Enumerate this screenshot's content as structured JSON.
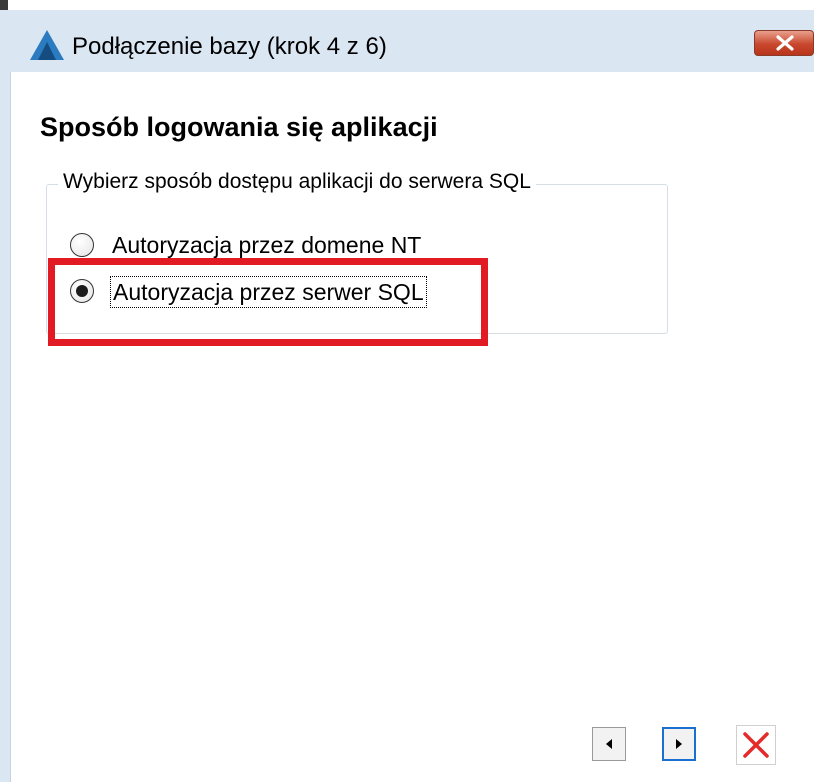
{
  "window": {
    "title": "Podłączenie bazy (krok 4 z 6)"
  },
  "content": {
    "heading": "Sposób logowania się aplikacji",
    "group_legend": "Wybierz sposób dostępu aplikacji do serwera SQL",
    "options": [
      {
        "label": "Autoryzacja przez domene NT",
        "selected": false
      },
      {
        "label": "Autoryzacja przez serwer SQL",
        "selected": true
      }
    ]
  },
  "icons": {
    "app": "app-logo-icon",
    "close": "close-icon",
    "prev": "arrow-left-icon",
    "next": "arrow-right-icon",
    "cancel": "cancel-x-icon"
  },
  "colors": {
    "highlight": "#e11a23",
    "cancel_x": "#e52a2a",
    "focus": "#1a6fd0",
    "logo": "#2a7bc0"
  }
}
